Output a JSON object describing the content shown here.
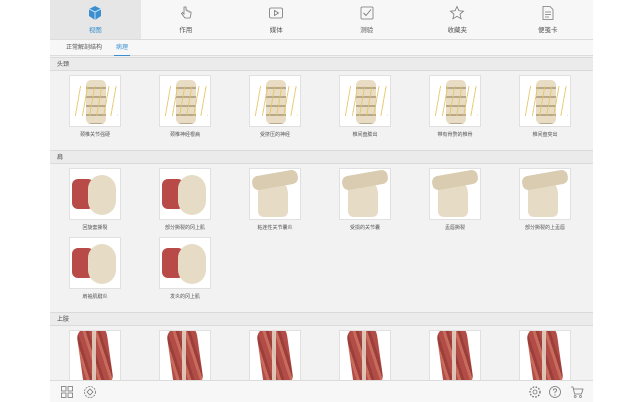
{
  "tabs": [
    {
      "label": "视图",
      "icon": "cube-icon",
      "active": true
    },
    {
      "label": "作用",
      "icon": "hand-pointer-icon",
      "active": false
    },
    {
      "label": "媒体",
      "icon": "play-icon",
      "active": false
    },
    {
      "label": "测验",
      "icon": "checkbox-icon",
      "active": false
    },
    {
      "label": "收藏夹",
      "icon": "star-icon",
      "active": false
    },
    {
      "label": "便笺卡",
      "icon": "note-card-icon",
      "active": false
    }
  ],
  "subtabs": [
    {
      "label": "正常解剖结构",
      "active": false
    },
    {
      "label": "病理",
      "active": true
    }
  ],
  "sections": [
    {
      "title": "头颈",
      "items": [
        {
          "label": "颈椎关节强硬",
          "kind": "spine"
        },
        {
          "label": "颈椎神经根病",
          "kind": "spine"
        },
        {
          "label": "受挤压的神经",
          "kind": "spine"
        },
        {
          "label": "椎间盘膨出",
          "kind": "spine"
        },
        {
          "label": "带有骨赘的椎骨",
          "kind": "spine"
        },
        {
          "label": "椎间盘突出",
          "kind": "spine"
        }
      ]
    },
    {
      "title": "肩",
      "items": [
        {
          "label": "回旋套撕裂",
          "kind": "muscle"
        },
        {
          "label": "部分撕裂的冈上肌",
          "kind": "muscle"
        },
        {
          "label": "粘连性关节囊炎",
          "kind": "shoulder"
        },
        {
          "label": "受损的关节囊",
          "kind": "shoulder"
        },
        {
          "label": "盂唇撕裂",
          "kind": "shoulder"
        },
        {
          "label": "部分撕裂的上盂唇",
          "kind": "shoulder"
        },
        {
          "label": "肩袖肌腱炎",
          "kind": "muscle"
        },
        {
          "label": "发炎的冈上肌",
          "kind": "muscle"
        }
      ]
    },
    {
      "title": "上肢",
      "items": [
        {
          "label": "",
          "kind": "arm"
        },
        {
          "label": "",
          "kind": "arm"
        },
        {
          "label": "",
          "kind": "arm"
        },
        {
          "label": "",
          "kind": "arm"
        },
        {
          "label": "",
          "kind": "arm"
        },
        {
          "label": "",
          "kind": "arm"
        }
      ]
    }
  ],
  "bottom_left_icons": [
    "grid-view-icon",
    "layers-icon"
  ],
  "bottom_right_icons": [
    "settings-gear-icon",
    "help-icon",
    "cart-icon"
  ],
  "colors": {
    "accent": "#3a8fd0"
  }
}
